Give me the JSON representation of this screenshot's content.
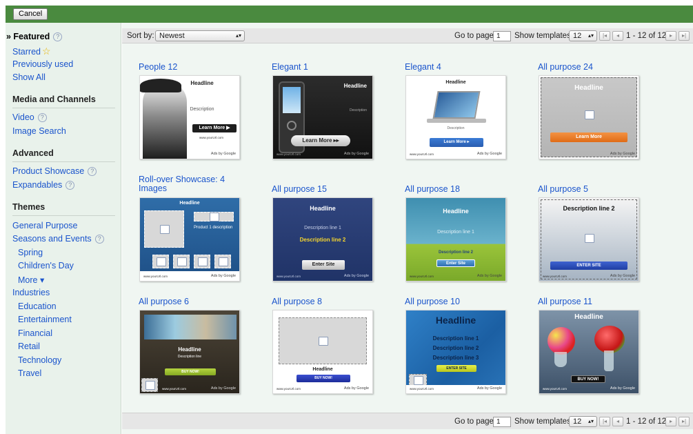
{
  "toolbar": {
    "cancel_label": "Cancel"
  },
  "sidebar": {
    "featured": "» Featured",
    "starred": "Starred",
    "previously_used": "Previously used",
    "show_all": "Show All",
    "media_heading": "Media and Channels",
    "video": "Video",
    "image_search": "Image Search",
    "advanced_heading": "Advanced",
    "product_showcase": "Product Showcase",
    "expandables": "Expandables",
    "themes_heading": "Themes",
    "general_purpose": "General Purpose",
    "seasons_events": "Seasons and Events",
    "spring": "Spring",
    "childrens_day": "Children's Day",
    "more": "More ▾",
    "industries": "Industries",
    "education": "Education",
    "entertainment": "Entertainment",
    "financial": "Financial",
    "retail": "Retail",
    "technology": "Technology",
    "travel": "Travel",
    "help_glyph": "?"
  },
  "sortbar": {
    "sort_label": "Sort by:",
    "sort_value": "Newest",
    "goto_label": "Go to page:",
    "goto_value": "1",
    "show_label": "Show templates:",
    "show_value": "12",
    "range": "1 - 12 of 12",
    "first_glyph": "|◂",
    "prev_glyph": "◂",
    "next_glyph": "▸",
    "last_glyph": "▸|",
    "select_arrows": "▴▾"
  },
  "templates": [
    {
      "title": "People 12",
      "headline": "Headline",
      "description": "Description",
      "button": "Learn More ▶",
      "url": "www.yourUrl.com",
      "ads": "Ads by Google"
    },
    {
      "title": "Elegant 1",
      "headline": "Headline",
      "description": "Description",
      "button": "Learn More ▸▸",
      "url": "www.yourUrl.com",
      "ads": "Ads by Google"
    },
    {
      "title": "Elegant 4",
      "headline": "Headline",
      "description": "Description",
      "button": "Learn More ▸",
      "url": "www.yourUrl.com",
      "ads": "Ads by Google"
    },
    {
      "title": "All purpose 24",
      "headline": "Headline",
      "button": "Learn More",
      "ads": "Ads by Google"
    },
    {
      "title": "Roll-over Showcase: 4 Images",
      "headline": "Headline",
      "description": "Product 1 description",
      "url": "www.yourUrl.com",
      "ads": "Ads by Google"
    },
    {
      "title": "All purpose 15",
      "headline": "Headline",
      "description": "Description line 1",
      "description2": "Description line 2",
      "button": "Enter Site",
      "url": "www.yourUrl.com",
      "ads": "Ads by Google"
    },
    {
      "title": "All purpose 18",
      "headline": "Headline",
      "description": "Description line 1",
      "description2": "Description line 2",
      "button": "Enter Site",
      "url": "www.yourUrl.com",
      "ads": "Ads by Google"
    },
    {
      "title": "All purpose 5",
      "headline": "Description line 2",
      "button": "ENTER SITE",
      "url": "www.yourUrl.com",
      "ads": "Ads by Google"
    },
    {
      "title": "All purpose 6",
      "headline": "Headline",
      "description": "Description line",
      "button": "BUY NOW!",
      "url": "www.yourUrl.com",
      "ads": "Ads by Google"
    },
    {
      "title": "All purpose 8",
      "headline": "Headline",
      "button": "BUY NOW!",
      "url": "www.yourUrl.com",
      "ads": "Ads by Google"
    },
    {
      "title": "All purpose 10",
      "headline": "Headline",
      "description": "Description line 1",
      "description2": "Description line 2",
      "description3": "Description line 3",
      "button": "ENTER SITE",
      "url": "www.yourUrl.com",
      "ads": "Ads by Google"
    },
    {
      "title": "All purpose 11",
      "headline": "Headline",
      "button": "BUY NOW!",
      "url": "www.yourUrl.com",
      "ads": "Ads by Google"
    }
  ]
}
